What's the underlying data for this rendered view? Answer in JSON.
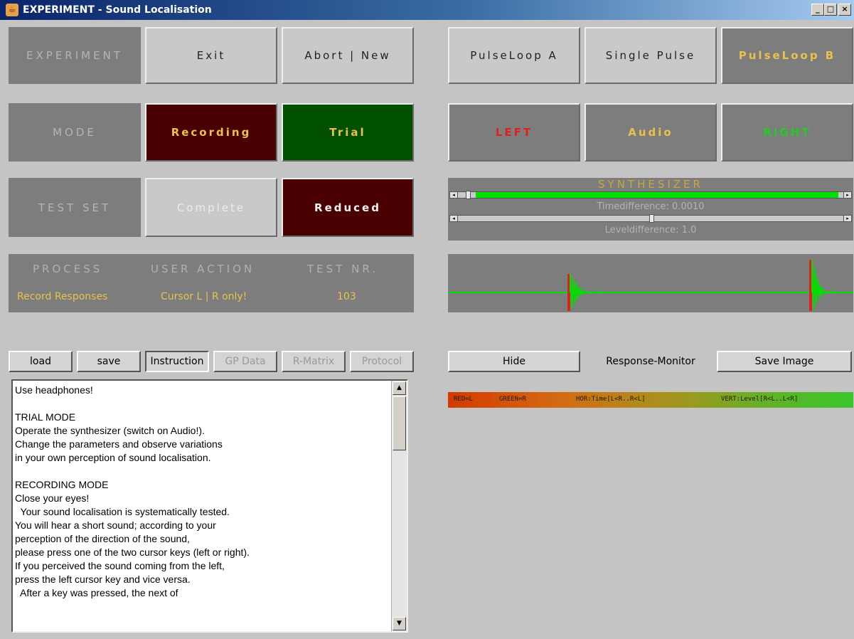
{
  "window": {
    "title": "EXPERIMENT - Sound Localisation",
    "controls": [
      "_",
      "□",
      "×"
    ]
  },
  "row1": {
    "label": "EXPERIMENT",
    "exit": "Exit",
    "abort_new": "Abort | New",
    "pulse_loop_a": "PulseLoop A",
    "single_pulse": "Single Pulse",
    "pulse_loop_b": "PulseLoop B"
  },
  "row2": {
    "label": "MODE",
    "recording": "Recording",
    "trial": "Trial",
    "left": "LEFT",
    "audio": "Audio",
    "right": "RIGHT"
  },
  "row3": {
    "label": "TEST SET",
    "complete": "Complete",
    "reduced": "Reduced"
  },
  "synthesizer": {
    "title": "SYNTHESIZER",
    "time_label": "Timedifference: 0.0010",
    "level_label": "Leveldifference: 1.0",
    "time_slider_fraction": 1.0,
    "level_slider_fraction": 0.5
  },
  "status": {
    "headers": [
      "PROCESS",
      "USER ACTION",
      "TEST NR."
    ],
    "values": [
      "Record Responses",
      "Cursor L | R only!",
      "103"
    ]
  },
  "toolbar": {
    "load": "load",
    "save": "save",
    "instruction": "Instruction",
    "gp_data": "GP Data",
    "r_matrix": "R-Matrix",
    "protocol": "Protocol"
  },
  "monitor": {
    "hide": "Hide",
    "label": "Response-Monitor",
    "save_image": "Save Image",
    "legend": [
      "RED=L",
      "GREEN=R",
      "HOR:Time[L<R..R<L]",
      "VERT:Level[R<L..L<R]"
    ]
  },
  "instructions": {
    "text": "Use headphones!\n\nTRIAL MODE\nOperate the synthesizer (switch on Audio!).\nChange the parameters and observe variations\nin your own perception of sound localisation.\n\nRECORDING MODE\nClose your eyes!\n  Your sound localisation is systematically tested.\nYou will hear a short sound; according to your\nperception of the direction of the sound,\nplease press one of the two cursor keys (left or right).\nIf you perceived the sound coming from the left,\npress the left cursor key and vice versa.\n  After a key was pressed, the next of"
  },
  "colors": {
    "panel_gray": "#7d7d7d",
    "button_gray": "#c9c9c9",
    "accent_yellow": "#e8c24a",
    "dark_red": "#4a0000",
    "dark_green": "#005000",
    "left_red": "#e02020",
    "right_green": "#22cc22",
    "signal_green": "#00e000"
  }
}
